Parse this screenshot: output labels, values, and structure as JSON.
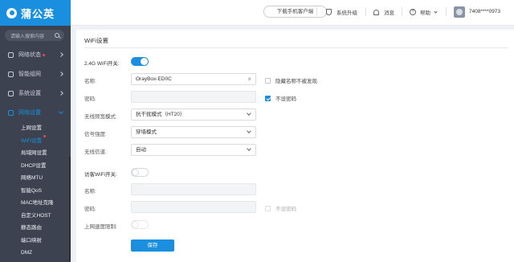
{
  "brand": {
    "name": "蒲公英"
  },
  "sidebar": {
    "search_placeholder": "请输入搜索内容",
    "groups": [
      {
        "label": "网络状态",
        "badge": true
      },
      {
        "label": "智能组网"
      },
      {
        "label": "系统设置"
      },
      {
        "label": "网络设置"
      }
    ],
    "sub_items": [
      {
        "label": "上网设置"
      },
      {
        "label": "WiFi设置",
        "badge": true
      },
      {
        "label": "局域网设置"
      },
      {
        "label": "DHCP设置"
      },
      {
        "label": "网络MTU"
      },
      {
        "label": "智能QoS"
      },
      {
        "label": "MAC地址克隆"
      },
      {
        "label": "自定义HOST"
      },
      {
        "label": "静态路由"
      },
      {
        "label": "端口映射"
      },
      {
        "label": "DMZ"
      }
    ]
  },
  "topbar": {
    "download_client": "下载手机客户端",
    "system_upgrade": "系统升级",
    "messages": "消息",
    "help": "帮助",
    "user_id": "7408****0973"
  },
  "wifi": {
    "title": "WiFi设置",
    "band24_label": "2.4G WiFi开关:",
    "name_label": "名称:",
    "name_value": "OrayBox-ED0C",
    "hide_name_label": "隐藏名称不被发现",
    "password_label": "密码:",
    "password_value": "",
    "no_password_label": "不设密码",
    "mode_label": "无线频宽模式:",
    "mode_value": "抗干扰模式（HT20）",
    "signal_label": "信号强度:",
    "signal_value": "穿墙模式",
    "channel_label": "无线信道:",
    "channel_value": "自动"
  },
  "guest": {
    "switch_label": "访客WiFi开关:",
    "name_label": "名称:",
    "password_label": "密码:",
    "no_password_label": "不设密码",
    "speed_limit_label": "上网速度限制:"
  },
  "actions": {
    "save": "保存"
  },
  "colors": {
    "accent": "#1a8fe0",
    "sidebar_bg": "#3d4250",
    "badge": "#e5484d"
  }
}
